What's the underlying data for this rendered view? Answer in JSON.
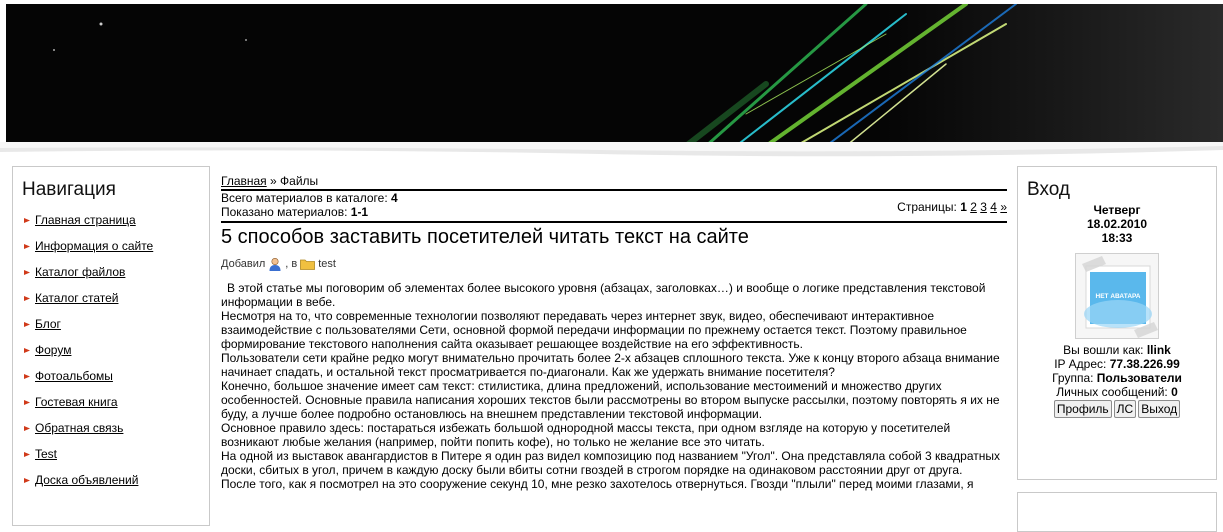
{
  "navigation": {
    "title": "Навигация",
    "items": [
      {
        "label": "Главная страница"
      },
      {
        "label": "Информация о сайте"
      },
      {
        "label": "Каталог файлов"
      },
      {
        "label": "Каталог статей"
      },
      {
        "label": "Блог"
      },
      {
        "label": "Форум"
      },
      {
        "label": "Фотоальбомы"
      },
      {
        "label": "Гостевая книга"
      },
      {
        "label": "Обратная связь"
      },
      {
        "label": "Test"
      },
      {
        "label": "Доска объявлений"
      }
    ]
  },
  "breadcrumb": {
    "home": "Главная",
    "sep": " » ",
    "current": "Файлы"
  },
  "catalog": {
    "total_label": "Всего материалов в каталоге: ",
    "total_value": "4",
    "shown_label": "Показано материалов: ",
    "shown_value": "1-1"
  },
  "pager": {
    "label": "Страницы: ",
    "current": "1",
    "pages": [
      "2",
      "3",
      "4"
    ],
    "next": "»"
  },
  "article": {
    "title": "5 способов заставить посетителей читать текст на сайте",
    "added_label": "Добавил",
    "in_label": ", в",
    "category": "test",
    "paragraphs": [
      "В этой статье мы поговорим об элементах более высокого уровня (абзацах, заголовках…) и вообще о логике представления текстовой информации в вебе.",
      "Несмотря на то, что современные технологии позволяют передавать через интернет звук, видео, обеспечивают интерактивное взаимодействие с пользователями Сети, основной формой передачи информации по прежнему остается текст. Поэтому правильное формирование текстового наполнения сайта оказывает решающее воздействие на его эффективность.",
      "Пользователи сети крайне редко могут внимательно прочитать более 2-х абзацев сплошного текста. Уже к концу второго абзаца внимание начинает спадать, и остальной текст просматривается по-диагонали. Как же удержать внимание посетителя?",
      "Конечно, большое значение имеет сам текст: стилистика, длина предложений, использование местоимений и множество других особенностей. Основные правила написания хороших текстов были рассмотрены во втором выпуске рассылки, поэтому повторять я их не буду, а лучше более подробно остановлюсь на внешнем представлении текстовой информации.",
      "Основное правило здесь: постараться избежать большой однородной массы текста, при одном взгляде на которую у посетителей возникают любые желания (например, пойти попить кофе), но только не желание все это читать.",
      "На одной из выставок авангардистов в Питере я один раз видел композицию под названием \"Угол\". Она представляла собой 3 квадратных доски, сбитых в угол, причем в каждую доску были вбиты сотни гвоздей в строгом порядке на одинаковом расстоянии друг от друга.",
      "После того, как я посмотрел на это сооружение секунд 10, мне резко захотелось отвернуться. Гвозди \"плыли\" перед моими глазами, я"
    ]
  },
  "login": {
    "title": "Вход",
    "day": "Четверг",
    "date": "18.02.2010",
    "time": "18:33",
    "avatar_text": "НЕТ АВАТАРА",
    "logged_as_label": "Вы вошли как: ",
    "username": "llink",
    "ip_label": "IP Адрес: ",
    "ip": "77.38.226.99",
    "group_label": "Группа: ",
    "group": "Пользователи",
    "pm_label": "Личных сообщений: ",
    "pm_count": "0",
    "buttons": {
      "profile": "Профиль",
      "ls": "ЛС",
      "logout": "Выход"
    }
  },
  "colors": {
    "banner_bg": "#050505",
    "border": "#c9c9c9",
    "bullet": "#d03a1a",
    "folder": "#f0c040"
  }
}
